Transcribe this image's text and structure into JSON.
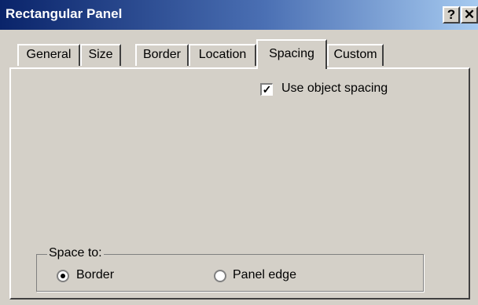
{
  "window": {
    "title": "Rectangular Panel",
    "help_button": "?",
    "close_button": "✕"
  },
  "tabs": [
    {
      "label": "General"
    },
    {
      "label": "Size"
    },
    {
      "label": "Border"
    },
    {
      "label": "Location"
    },
    {
      "label": "Spacing"
    },
    {
      "label": "Custom"
    }
  ],
  "active_tab": "Spacing",
  "spacing": {
    "use_object_spacing": {
      "label": "Use object spacing",
      "checked": true,
      "check_mark": "✓"
    },
    "space_to": {
      "legend": "Space to:",
      "options": [
        {
          "label": "Border",
          "selected": true
        },
        {
          "label": "Panel edge",
          "selected": false
        }
      ]
    }
  }
}
